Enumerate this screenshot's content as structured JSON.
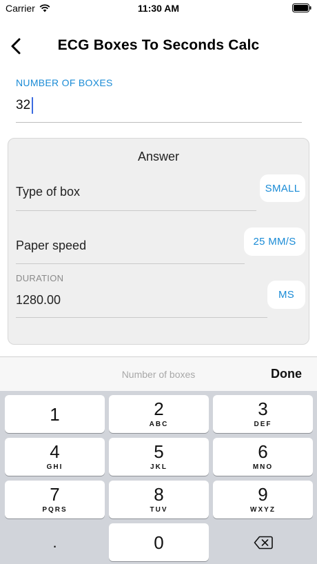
{
  "status_bar": {
    "carrier": "Carrier",
    "time": "11:30 AM"
  },
  "nav": {
    "title": "ECG Boxes To  Seconds Calc"
  },
  "input": {
    "label": "NUMBER OF BOXES",
    "value": "32"
  },
  "answer": {
    "title": "Answer",
    "box_type": {
      "label": "Type of box",
      "value": "SMALL"
    },
    "paper_speed": {
      "label": "Paper speed",
      "value": "25 MM/S"
    },
    "duration": {
      "label": "DURATION",
      "value": "1280.00",
      "unit": "MS"
    }
  },
  "accessory": {
    "placeholder": "Number of boxes",
    "done": "Done"
  },
  "keyboard": {
    "keys": [
      {
        "digit": "1",
        "letters": ""
      },
      {
        "digit": "2",
        "letters": "ABC"
      },
      {
        "digit": "3",
        "letters": "DEF"
      },
      {
        "digit": "4",
        "letters": "GHI"
      },
      {
        "digit": "5",
        "letters": "JKL"
      },
      {
        "digit": "6",
        "letters": "MNO"
      },
      {
        "digit": "7",
        "letters": "PQRS"
      },
      {
        "digit": "8",
        "letters": "TUV"
      },
      {
        "digit": "9",
        "letters": "WXYZ"
      }
    ],
    "decimal": ".",
    "zero": "0"
  }
}
